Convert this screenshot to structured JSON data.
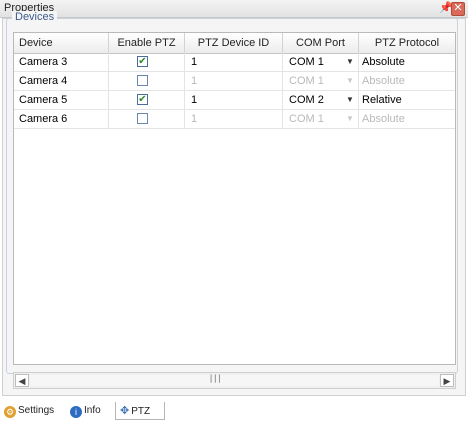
{
  "window": {
    "title": "Properties"
  },
  "devices_group": {
    "label": "Devices",
    "columns": [
      "Device",
      "Enable PTZ",
      "PTZ Device ID",
      "COM Port",
      "PTZ Protocol"
    ],
    "rows": [
      {
        "device": "Camera 3",
        "enabled": true,
        "ptz_id": "1",
        "com_port": "COM 1",
        "protocol": "Absolute"
      },
      {
        "device": "Camera 4",
        "enabled": false,
        "ptz_id": "1",
        "com_port": "COM 1",
        "protocol": "Absolute"
      },
      {
        "device": "Camera 5",
        "enabled": true,
        "ptz_id": "1",
        "com_port": "COM 2",
        "protocol": "Relative"
      },
      {
        "device": "Camera 6",
        "enabled": false,
        "ptz_id": "1",
        "com_port": "COM 1",
        "protocol": "Absolute"
      }
    ]
  },
  "tabs": [
    {
      "label": "Settings",
      "icon": "settings-icon"
    },
    {
      "label": "Info",
      "icon": "info-icon"
    },
    {
      "label": "PTZ",
      "icon": "ptz-icon",
      "active": true
    }
  ],
  "colors": {
    "group_label": "#3a5b8c",
    "checkmark": "#2f8a2f",
    "disabled_text": "#b9b9b9"
  }
}
